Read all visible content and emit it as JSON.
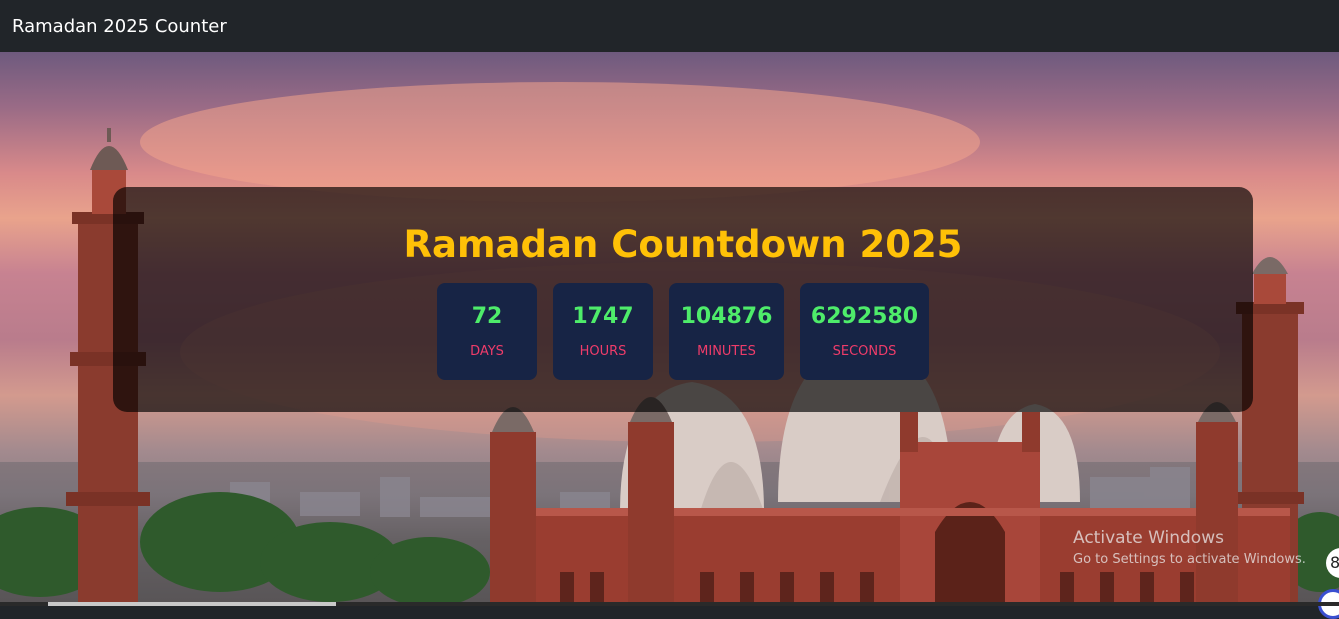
{
  "navbar": {
    "brand": "Ramadan 2025 Counter"
  },
  "countdown": {
    "title": "Ramadan Countdown 2025",
    "units": [
      {
        "value": "72",
        "label": "DAYS"
      },
      {
        "value": "1747",
        "label": "HOURS"
      },
      {
        "value": "104876",
        "label": "MINUTES"
      },
      {
        "value": "6292580",
        "label": "SECONDS"
      }
    ]
  },
  "watermark": {
    "line1": "Activate Windows",
    "line2": "Go to Settings to activate Windows."
  },
  "side_button_glyph": "8",
  "colors": {
    "navbar_bg": "#212529",
    "title": "#ffc107",
    "number": "#4eec6a",
    "unit_label": "#ef3c6a",
    "box_bg": "#172445"
  }
}
